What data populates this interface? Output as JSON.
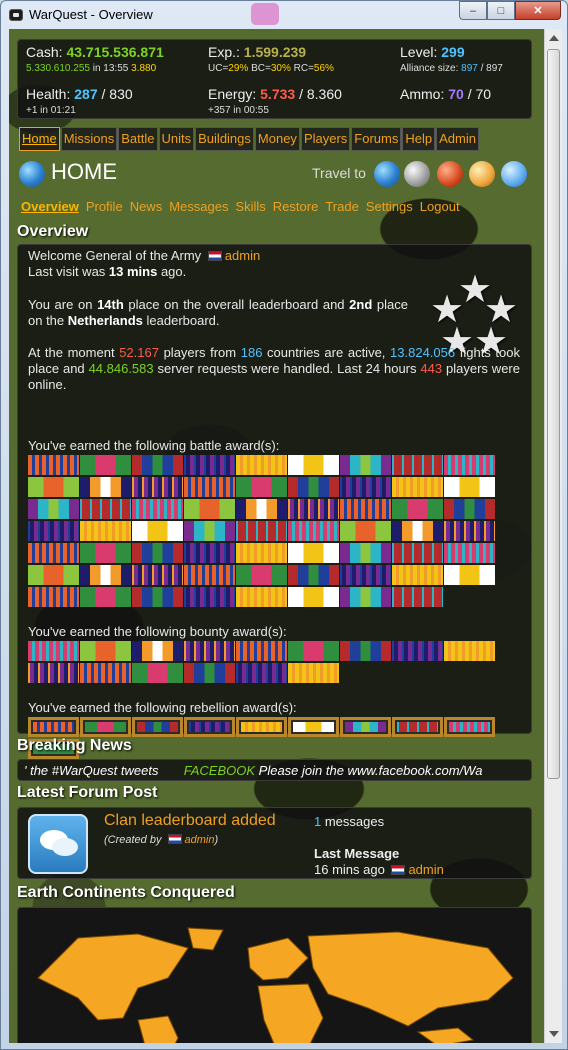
{
  "window": {
    "title": "WarQuest - Overview",
    "minimize": "–",
    "maximize": "□",
    "close": "✕"
  },
  "stats": {
    "cash_label": "Cash:",
    "cash_value": "43.715.536.871",
    "cash_sub_value": "5.330.610.255",
    "cash_sub_in": " in 13:55 ",
    "cash_sub_extra": "3.880",
    "exp_label": "Exp.:",
    "exp_value": "1.599.239",
    "uc_label": "UC=",
    "uc_value": "29%",
    "bc_label": " BC=",
    "bc_value": "30%",
    "rc_label": " RC=",
    "rc_value": "56%",
    "level_label": "Level:",
    "level_value": "299",
    "alliance_label": "Alliance size: ",
    "alliance_value": "897",
    "alliance_max": " / 897",
    "health_label": "Health:",
    "health_value": "287",
    "health_max": " / 830",
    "health_sub": "+1 in 01:21",
    "energy_label": "Energy:",
    "energy_value": "5.733",
    "energy_max": " / 8.360",
    "energy_sub": "+357 in 00:55",
    "ammo_label": "Ammo:",
    "ammo_value": "70",
    "ammo_max": " / 70"
  },
  "menu": [
    "Home",
    "Missions",
    "Battle",
    "Units",
    "Buildings",
    "Money",
    "Players",
    "Forums",
    "Help",
    "Admin"
  ],
  "home": {
    "title": "HOME",
    "travel_label": "Travel to"
  },
  "subnav": [
    "Overview",
    "Profile",
    "News",
    "Messages",
    "Skills",
    "Restore",
    "Trade",
    "Settings",
    "Logout"
  ],
  "overview": {
    "section_title": "Overview",
    "welcome_prefix": "Welcome General of the Army ",
    "welcome_name": "admin",
    "last_visit_prefix": "Last visit was ",
    "last_visit_value": "13 mins",
    "last_visit_suffix": " ago.",
    "rank_p1": "You are on ",
    "rank_place": "14th",
    "rank_p2": " place on the overall leaderboard and ",
    "rank_country_place": "2nd",
    "rank_p3": " place on the ",
    "rank_country": "Netherlands",
    "rank_p4": " leaderboard.",
    "moment_p1": "At the moment ",
    "players_count": "52.167",
    "moment_p2": " players from ",
    "countries_count": "186",
    "moment_p3": " countries are active, ",
    "fights_count": "13.824.056",
    "moment_p4": " fights took place and ",
    "requests_count": "44.846.583",
    "moment_p5": " server requests were handled. Last 24 hours ",
    "online_count": "443",
    "moment_p6": " players were online.",
    "battle_awards_label": "You've earned the following battle award(s):",
    "bounty_awards_label": "You've earned the following bounty award(s):",
    "rebellion_awards_label": "You've earned the following rebellion award(s):"
  },
  "news": {
    "section_title": "Breaking News",
    "ticker_a": "' the #WarQuest tweets",
    "ticker_b": "FACEBOOK",
    "ticker_c": " Please join the www.facebook.com/Wa"
  },
  "forum": {
    "section_title": "Latest Forum Post",
    "post_title": "Clan leaderboard added",
    "created_by_prefix": "(Created by ",
    "created_by_name": "admin",
    "created_by_suffix": ")",
    "messages_count": "1",
    "messages_label": " messages",
    "last_message_label": "Last Message",
    "last_message_time": "16 mins ago ",
    "last_message_user": "admin"
  },
  "continents": {
    "section_title": "Earth Continents Conquered"
  },
  "colors": {
    "accent": "#f0a020",
    "green": "#7ed321",
    "blue": "#4fc3ff",
    "red": "#ff5a4a",
    "map_land": "#f5a623"
  },
  "icons": [
    "globe-icon",
    "moon-icon",
    "mars-icon",
    "venus-icon",
    "neptune-icon",
    "stars-rank-icon",
    "forum-chat-icon",
    "netherlands-flag-icon"
  ]
}
